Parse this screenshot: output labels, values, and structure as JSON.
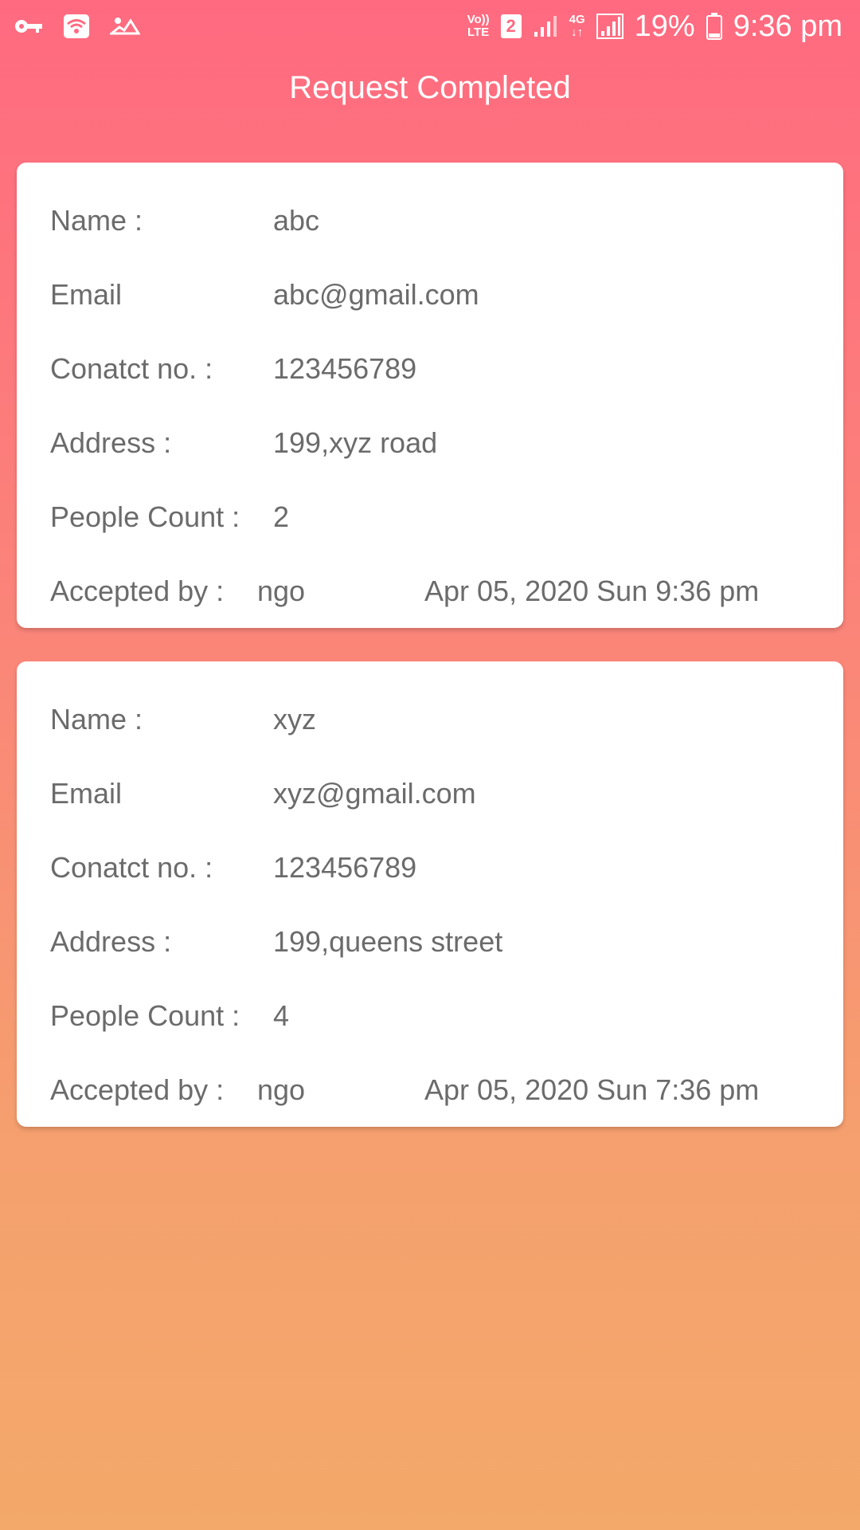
{
  "status_bar": {
    "lte_top": "Vo))",
    "lte_bottom": "LTE",
    "sim_number": "2",
    "network_type": "4G",
    "battery": "19%",
    "time": "9:36 pm",
    "icons": [
      "vpn-key-icon",
      "wifi-icon",
      "app-notification-icon",
      "volte-icon",
      "sim-icon",
      "signal-icon",
      "signal-icon",
      "battery-icon"
    ]
  },
  "header": {
    "title": "Request Completed"
  },
  "requests": [
    {
      "name_label": "Name :",
      "name": "abc",
      "email_label": "Email",
      "email": "abc@gmail.com",
      "contact_label": "Conatct no. :",
      "contact": "123456789",
      "address_label": "Address :",
      "address": "199,xyz road",
      "people_label": "People Count :",
      "people_count": "2",
      "accepted_label": "Accepted by :",
      "accepted_by": "ngo",
      "datetime": "Apr 05, 2020 Sun 9:36 pm"
    },
    {
      "name_label": "Name :",
      "name": "xyz",
      "email_label": "Email",
      "email": "xyz@gmail.com",
      "contact_label": "Conatct no. :",
      "contact": "123456789",
      "address_label": "Address :",
      "address": "199,queens street",
      "people_label": "People Count :",
      "people_count": "4",
      "accepted_label": "Accepted by :",
      "accepted_by": "ngo",
      "datetime": "Apr 05, 2020 Sun 7:36 pm"
    }
  ],
  "colors": {
    "gradient_top": "#ff6a80",
    "gradient_bottom": "#f3a96a",
    "card_background": "#ffffff",
    "text": "#6b6b6b"
  }
}
